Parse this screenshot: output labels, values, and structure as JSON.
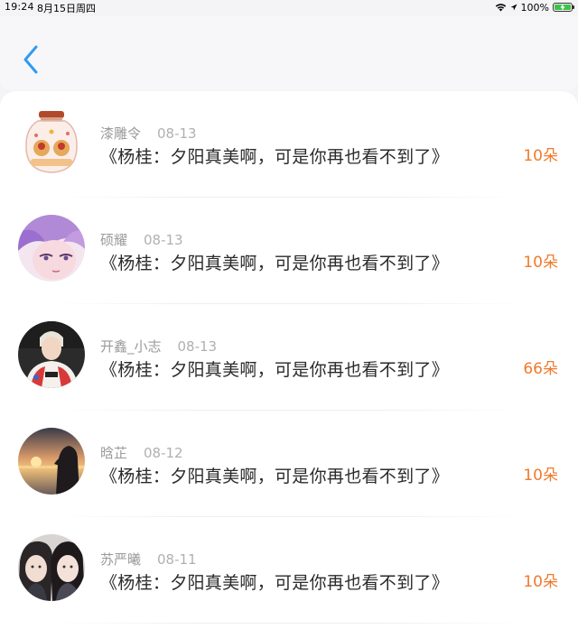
{
  "status_bar": {
    "time": "19:24",
    "date": "8月15日周四",
    "battery": "100%"
  },
  "header": {
    "back_icon": "chevron-left-icon",
    "accent_color": "#2f9bf2"
  },
  "items": [
    {
      "name": "漆雕令",
      "date": "08-13",
      "title": "《杨桂：夕阳真美啊，可是你再也看不到了》",
      "count": "10朵",
      "avatar_icon": "jar-avatar"
    },
    {
      "name": "硕耀",
      "date": "08-13",
      "title": "《杨桂：夕阳真美啊，可是你再也看不到了》",
      "count": "10朵",
      "avatar_icon": "anime-avatar"
    },
    {
      "name": "开鑫_小志",
      "date": "08-13",
      "title": "《杨桂：夕阳真美啊，可是你再也看不到了》",
      "count": "66朵",
      "avatar_icon": "person-avatar"
    },
    {
      "name": "晗芷",
      "date": "08-12",
      "title": "《杨桂：夕阳真美啊，可是你再也看不到了》",
      "count": "10朵",
      "avatar_icon": "sunset-avatar"
    },
    {
      "name": "苏严曦",
      "date": "08-11",
      "title": "《杨桂：夕阳真美啊，可是你再也看不到了》",
      "count": "10朵",
      "avatar_icon": "couple-avatar"
    }
  ],
  "colors": {
    "count": "#f07a2c",
    "name": "#9a9a9a",
    "title": "#2a2a2a"
  }
}
